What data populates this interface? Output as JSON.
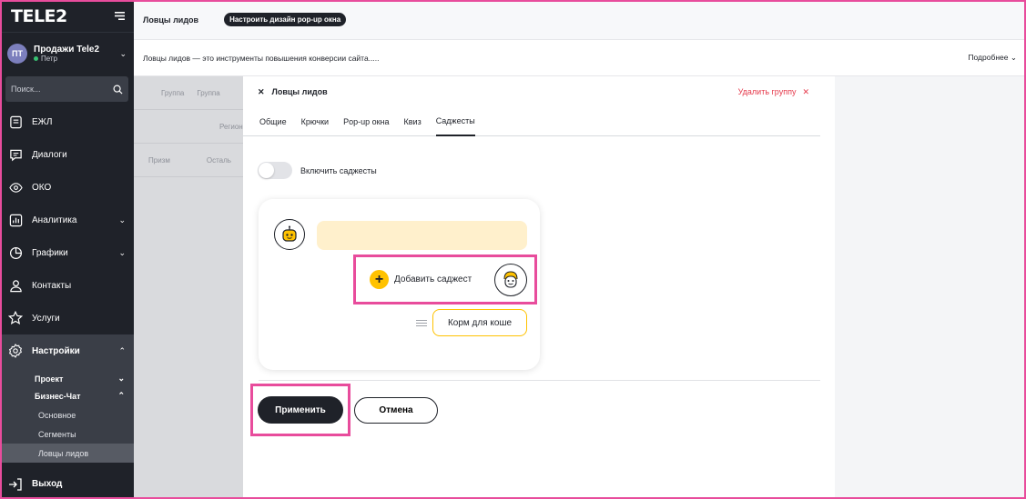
{
  "sidebar": {
    "logo": "TELE2",
    "user": {
      "initials": "ПТ",
      "name": "Продажи Tele2",
      "sub": "Петр"
    },
    "search_placeholder": "Поиск...",
    "items": [
      {
        "label": "ЕЖЛ",
        "icon": "document-icon"
      },
      {
        "label": "Диалоги",
        "icon": "chat-icon"
      },
      {
        "label": "ОКО",
        "icon": "eye-icon"
      },
      {
        "label": "Аналитика",
        "icon": "analytics-icon"
      },
      {
        "label": "Графики",
        "icon": "pie-chart-icon"
      },
      {
        "label": "Контакты",
        "icon": "contacts-icon"
      },
      {
        "label": "Услуги",
        "icon": "star-icon"
      },
      {
        "label": "Настройки",
        "icon": "gear-icon"
      }
    ],
    "sub": {
      "project": "Проект",
      "business_chat": "Бизнес-Чат",
      "main": "Основное",
      "segments": "Сегменты",
      "lead_catchers": "Ловцы лидов"
    },
    "logout": "Выход"
  },
  "topbar": {
    "title": "Ловцы лидов",
    "button": "Настроить дизайн pop-up окна"
  },
  "infobar": {
    "text": "Ловцы лидов — это инструменты повышения конверсии сайта.....",
    "more": "Подробнее"
  },
  "background": {
    "col1": "Группа",
    "col2": "Группа",
    "row1": "Регион",
    "row2a": "Призм",
    "row2b": "Осталь"
  },
  "panel": {
    "title": "Ловцы лидов",
    "delete": "Удалить группу",
    "tabs": [
      "Общие",
      "Крючки",
      "Pop-up окна",
      "Квиз",
      "Саджесты"
    ],
    "active_tab": "Саджесты",
    "toggle_label": "Включить саджесты",
    "toggle_on": false,
    "add_suggest": "Добавить саджест",
    "chip": "Корм для коше",
    "apply": "Применить",
    "cancel": "Отмена"
  },
  "colors": {
    "accent_yellow": "#ffc200",
    "highlight": "#e84c9c",
    "sidebar_bg": "#1f2229",
    "danger": "#e5394b"
  }
}
